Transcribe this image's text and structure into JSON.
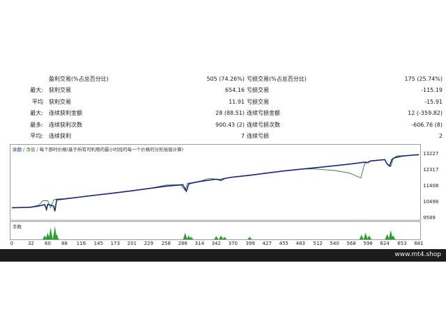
{
  "stats": [
    {
      "prefix": "",
      "left_label": "盈利交易(%占总百分比)",
      "left_value": "505 (74.26%)",
      "right_label": "亏损交易(%占总百分比)",
      "right_value": "175 (25.74%)"
    },
    {
      "prefix": "最大:",
      "left_label": "获利交易",
      "left_value": "654.16",
      "right_label": "亏损交易",
      "right_value": "-115.19"
    },
    {
      "prefix": "平均",
      "left_label": "获利交易",
      "left_value": "11.91",
      "right_label": "亏损交易",
      "right_value": "-15.91"
    },
    {
      "prefix": "最大:",
      "left_label": "连续获利金额",
      "left_value": "28 (88.51)",
      "right_label": "连续亏损金额",
      "right_value": "12 (-359.82)"
    },
    {
      "prefix": "最多:",
      "left_label": "连续获利次数",
      "left_value": "900.43 (2)",
      "right_label": "连续亏损次数",
      "right_value": "-606.76 (8)"
    },
    {
      "prefix": "平均:",
      "left_label": "连续获利",
      "left_value": "7",
      "right_label": "连续亏损",
      "right_value": "2"
    }
  ],
  "chart": {
    "legend_balance": "余额",
    "legend_sep": " / ",
    "legend_equity": "净值",
    "legend_rest": " / 每个部时价格(基于所有可利用的最小时段的每一个价格的分形插值计算)",
    "lots_label": "手数",
    "balance_color": "#1a237e",
    "equity_color": "#2e7d32",
    "lots_color": "#2e9e2e"
  },
  "chart_data": {
    "type": "line",
    "ylim": [
      9589,
      13400
    ],
    "y_ticks": [
      9589,
      10498,
      11408,
      12317,
      13227
    ],
    "x_ticks": [
      0,
      32,
      60,
      88,
      116,
      145,
      173,
      201,
      229,
      258,
      286,
      314,
      342,
      370,
      399,
      427,
      455,
      483,
      512,
      540,
      568,
      596,
      624,
      653,
      681
    ],
    "xlim": [
      0,
      681
    ],
    "series": [
      {
        "values": [
          [
            0,
            10200
          ],
          [
            30,
            10230
          ],
          [
            45,
            10300
          ],
          [
            55,
            10380
          ],
          [
            58,
            10100
          ],
          [
            60,
            10400
          ],
          [
            70,
            10300
          ],
          [
            72,
            10000
          ],
          [
            75,
            10650
          ],
          [
            88,
            10700
          ],
          [
            116,
            10820
          ],
          [
            145,
            10940
          ],
          [
            173,
            11050
          ],
          [
            201,
            11170
          ],
          [
            229,
            11300
          ],
          [
            258,
            11430
          ],
          [
            286,
            11520
          ],
          [
            292,
            11150
          ],
          [
            296,
            11560
          ],
          [
            300,
            11600
          ],
          [
            314,
            11700
          ],
          [
            342,
            11830
          ],
          [
            350,
            11760
          ],
          [
            356,
            11870
          ],
          [
            370,
            11950
          ],
          [
            399,
            12060
          ],
          [
            427,
            12180
          ],
          [
            455,
            12300
          ],
          [
            483,
            12400
          ],
          [
            512,
            12500
          ],
          [
            540,
            12600
          ],
          [
            568,
            12700
          ],
          [
            590,
            12800
          ],
          [
            596,
            12780
          ],
          [
            600,
            12870
          ],
          [
            610,
            12900
          ],
          [
            624,
            12950
          ],
          [
            628,
            12700
          ],
          [
            632,
            12580
          ],
          [
            636,
            12960
          ],
          [
            640,
            13050
          ],
          [
            653,
            13150
          ],
          [
            670,
            13200
          ],
          [
            681,
            13230
          ]
        ]
      },
      {
        "values": [
          [
            0,
            10200
          ],
          [
            30,
            10230
          ],
          [
            45,
            10350
          ],
          [
            52,
            10600
          ],
          [
            60,
            10600
          ],
          [
            65,
            10200
          ],
          [
            70,
            10650
          ],
          [
            75,
            10700
          ],
          [
            88,
            10720
          ],
          [
            116,
            10830
          ],
          [
            145,
            10950
          ],
          [
            173,
            11060
          ],
          [
            201,
            11180
          ],
          [
            229,
            11300
          ],
          [
            258,
            11500
          ],
          [
            282,
            11520
          ],
          [
            290,
            11200
          ],
          [
            294,
            11600
          ],
          [
            300,
            11620
          ],
          [
            314,
            11710
          ],
          [
            330,
            11880
          ],
          [
            345,
            11820
          ],
          [
            356,
            11880
          ],
          [
            370,
            11960
          ],
          [
            399,
            12070
          ],
          [
            427,
            12190
          ],
          [
            455,
            12310
          ],
          [
            483,
            12410
          ],
          [
            505,
            12420
          ],
          [
            540,
            12330
          ],
          [
            565,
            12180
          ],
          [
            584,
            11900
          ],
          [
            590,
            12700
          ],
          [
            600,
            12880
          ],
          [
            612,
            12910
          ],
          [
            624,
            12940
          ],
          [
            628,
            12700
          ],
          [
            634,
            12550
          ],
          [
            638,
            12980
          ],
          [
            644,
            13160
          ],
          [
            653,
            13170
          ],
          [
            670,
            13210
          ],
          [
            681,
            13240
          ]
        ]
      }
    ],
    "lots": [
      [
        55,
        0.3
      ],
      [
        60,
        0.5
      ],
      [
        65,
        0.9
      ],
      [
        72,
        1
      ],
      [
        75,
        0.4
      ],
      [
        290,
        0.5
      ],
      [
        296,
        0.3
      ],
      [
        300,
        0.2
      ],
      [
        342,
        0.25
      ],
      [
        350,
        0.3
      ],
      [
        356,
        0.2
      ],
      [
        398,
        0.2
      ],
      [
        585,
        0.35
      ],
      [
        592,
        0.5
      ],
      [
        598,
        0.3
      ],
      [
        628,
        0.4
      ],
      [
        634,
        0.7
      ],
      [
        638,
        0.3
      ]
    ]
  },
  "footer": {
    "site": "www.mt4.shop"
  }
}
